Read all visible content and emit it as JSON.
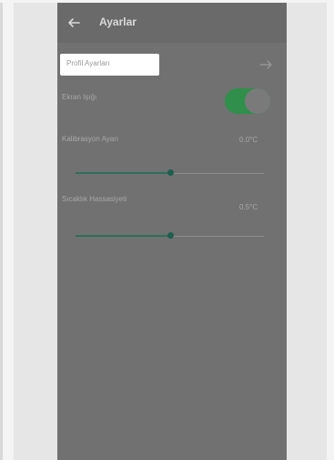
{
  "header": {
    "title": "Ayarlar"
  },
  "profile_row": {
    "label": "Profil Ayarları"
  },
  "dark_mode": {
    "label": "Ekran Işığı",
    "enabled": true
  },
  "calibration": {
    "label": "Kalibrasyon Ayarı",
    "value": "0.0°C",
    "level": 0.5
  },
  "sensitivity": {
    "label": "Sıcaklık Hassasiyeti",
    "value": "0.5°C",
    "level": 0.5
  },
  "colors": {
    "accent": "#2f8f4b",
    "slider": "#1e5f4e"
  },
  "icons": {
    "back": "arrow-left-icon",
    "forward": "arrow-right-icon"
  }
}
